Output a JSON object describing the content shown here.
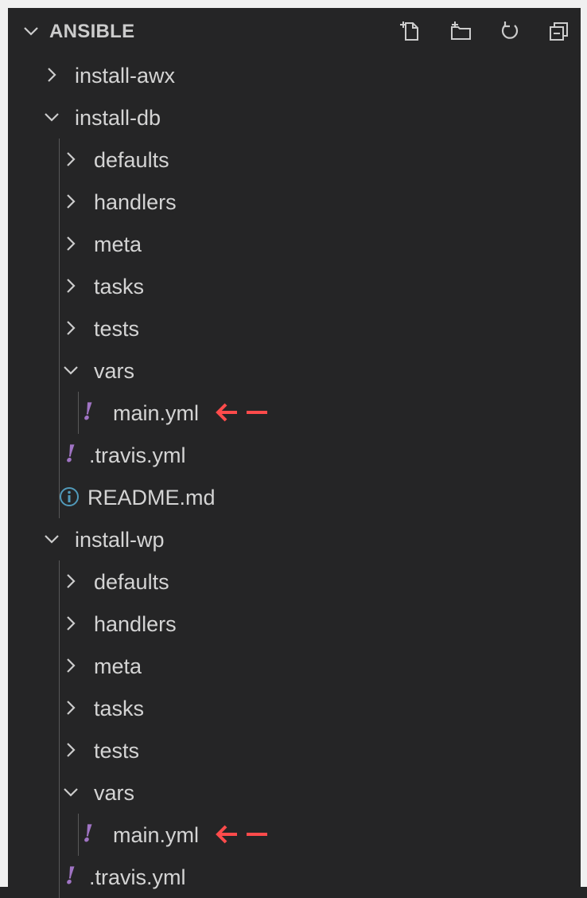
{
  "explorer": {
    "title": "ANSIBLE",
    "actions": [
      {
        "name": "new-file-icon"
      },
      {
        "name": "new-folder-icon"
      },
      {
        "name": "refresh-icon"
      },
      {
        "name": "collapse-all-icon"
      }
    ]
  },
  "tree": [
    {
      "label": "install-awx",
      "type": "folder",
      "expanded": false,
      "depth": 0
    },
    {
      "label": "install-db",
      "type": "folder",
      "expanded": true,
      "depth": 0
    },
    {
      "label": "defaults",
      "type": "folder",
      "expanded": false,
      "depth": 1
    },
    {
      "label": "handlers",
      "type": "folder",
      "expanded": false,
      "depth": 1
    },
    {
      "label": "meta",
      "type": "folder",
      "expanded": false,
      "depth": 1
    },
    {
      "label": "tasks",
      "type": "folder",
      "expanded": false,
      "depth": 1
    },
    {
      "label": "tests",
      "type": "folder",
      "expanded": false,
      "depth": 1
    },
    {
      "label": "vars",
      "type": "folder",
      "expanded": true,
      "depth": 1
    },
    {
      "label": "main.yml",
      "type": "yaml",
      "depth": 2,
      "annotated": true
    },
    {
      "label": ".travis.yml",
      "type": "yaml",
      "depth": 1
    },
    {
      "label": "README.md",
      "type": "info",
      "depth": 1
    },
    {
      "label": "install-wp",
      "type": "folder",
      "expanded": true,
      "depth": 0
    },
    {
      "label": "defaults",
      "type": "folder",
      "expanded": false,
      "depth": 1
    },
    {
      "label": "handlers",
      "type": "folder",
      "expanded": false,
      "depth": 1
    },
    {
      "label": "meta",
      "type": "folder",
      "expanded": false,
      "depth": 1
    },
    {
      "label": "tasks",
      "type": "folder",
      "expanded": false,
      "depth": 1
    },
    {
      "label": "tests",
      "type": "folder",
      "expanded": false,
      "depth": 1
    },
    {
      "label": "vars",
      "type": "folder",
      "expanded": true,
      "depth": 1
    },
    {
      "label": "main.yml",
      "type": "yaml",
      "depth": 2,
      "annotated": true
    },
    {
      "label": ".travis.yml",
      "type": "yaml",
      "depth": 1
    }
  ],
  "icons": {
    "yaml_glyph": "!",
    "yaml_color": "#a074c4",
    "info_color": "#519aba",
    "arrow_color": "#ff4b4b"
  }
}
